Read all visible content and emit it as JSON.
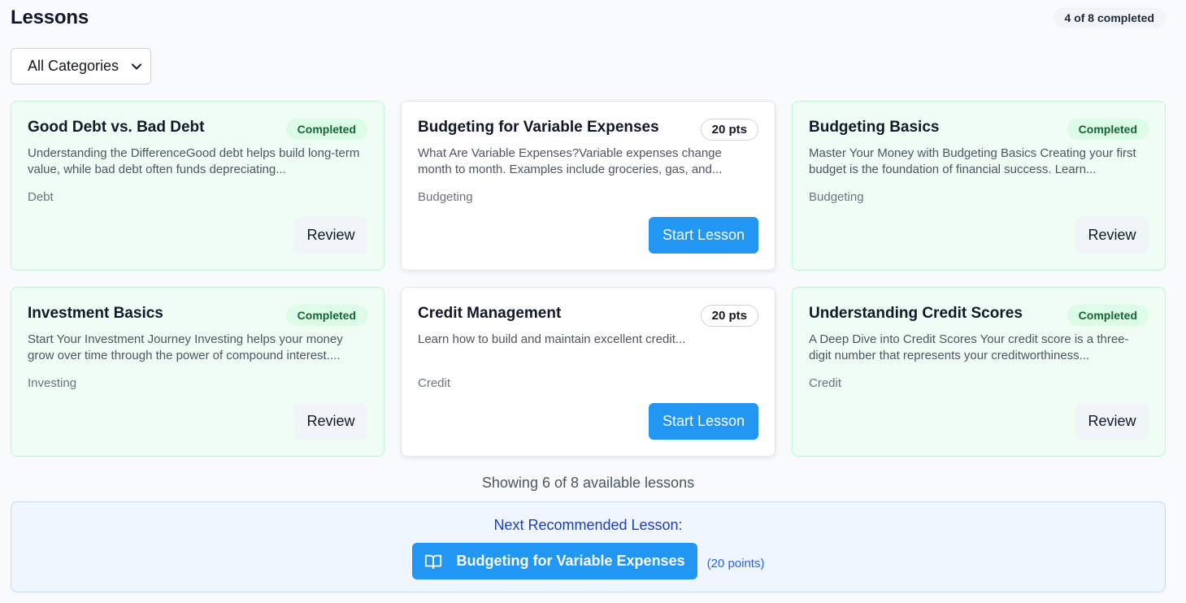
{
  "header": {
    "title": "Lessons",
    "progress": "4 of 8 completed"
  },
  "filter": {
    "selected": "All Categories"
  },
  "lessons": [
    {
      "title": "Good Debt vs. Bad Debt",
      "status": "Completed",
      "description": "Understanding the DifferenceGood debt helps build long-term value, while bad debt often funds depreciating...",
      "category": "Debt",
      "action": "Review"
    },
    {
      "title": "Budgeting for Variable Expenses",
      "status": "20 pts",
      "description": "What Are Variable Expenses?Variable expenses change month to month. Examples include groceries, gas, and...",
      "category": "Budgeting",
      "action": "Start Lesson"
    },
    {
      "title": "Budgeting Basics",
      "status": "Completed",
      "description": "Master Your Money with Budgeting Basics Creating your first budget is the foundation of financial success. Learn...",
      "category": "Budgeting",
      "action": "Review"
    },
    {
      "title": "Investment Basics",
      "status": "Completed",
      "description": "Start Your Investment Journey Investing helps your money grow over time through the power of compound interest....",
      "category": "Investing",
      "action": "Review"
    },
    {
      "title": "Credit Management",
      "status": "20 pts",
      "description": "Learn how to build and maintain excellent credit...",
      "category": "Credit",
      "action": "Start Lesson"
    },
    {
      "title": "Understanding Credit Scores",
      "status": "Completed",
      "description": "A Deep Dive into Credit Scores Your credit score is a three-digit number that represents your creditworthiness...",
      "category": "Credit",
      "action": "Review"
    }
  ],
  "showing_text": "Showing 6 of 8 available lessons",
  "recommendation": {
    "heading": "Next Recommended Lesson:",
    "lesson_title": "Budgeting for Variable Expenses",
    "points": "(20 points)",
    "icon": "book-icon"
  },
  "colors": {
    "accent": "#2196f3",
    "completed_bg": "#f0fdf4",
    "completed_badge": "#dcfce7",
    "recommend_bg": "#eff6ff"
  }
}
